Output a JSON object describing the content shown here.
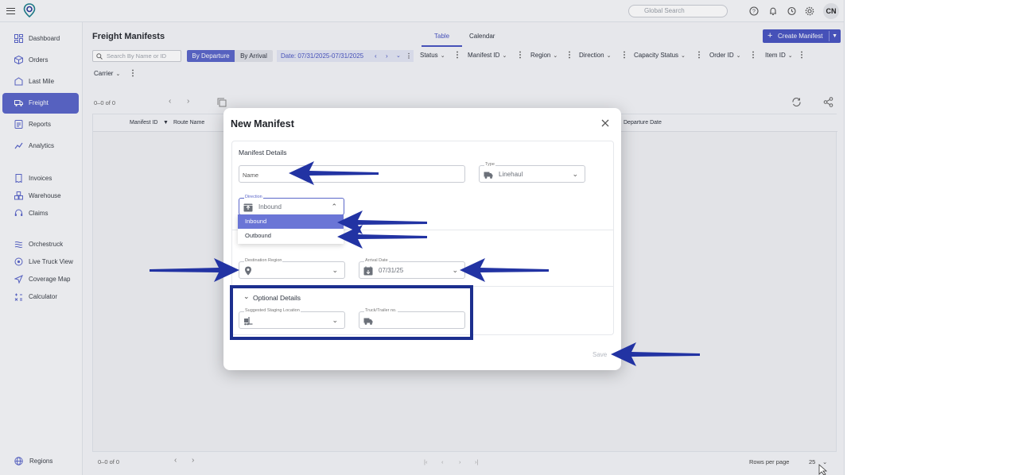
{
  "topbar": {
    "search_placeholder": "Global Search",
    "avatar_initials": "CN"
  },
  "sidebar": {
    "items": [
      {
        "label": "Dashboard",
        "icon": "dashboard-icon"
      },
      {
        "label": "Orders",
        "icon": "orders-box-icon"
      },
      {
        "label": "Last Mile",
        "icon": "last-mile-icon"
      },
      {
        "label": "Freight",
        "icon": "freight-truck-icon"
      },
      {
        "label": "Reports",
        "icon": "reports-icon"
      },
      {
        "label": "Analytics",
        "icon": "analytics-icon"
      },
      {
        "label": "Invoices",
        "icon": "invoices-icon"
      },
      {
        "label": "Warehouse",
        "icon": "warehouse-icon"
      },
      {
        "label": "Claims",
        "icon": "claims-headset-icon"
      },
      {
        "label": "Orchestruck",
        "icon": "orchestruck-icon"
      },
      {
        "label": "Live Truck View",
        "icon": "live-truck-view-icon"
      },
      {
        "label": "Coverage Map",
        "icon": "coverage-map-icon"
      },
      {
        "label": "Calculator",
        "icon": "calculator-icon"
      },
      {
        "label": "Regions",
        "icon": "globe-icon"
      }
    ],
    "active": "Freight"
  },
  "page": {
    "title": "Freight Manifests",
    "tabs": [
      "Table",
      "Calendar"
    ],
    "active_tab": "Table",
    "create_button": "Create Manifest",
    "filter_search_placeholder": "Search By Name or ID",
    "by_departure": "By Departure",
    "by_arrival": "By Arrival",
    "date_filter": "Date: 07/31/2025-07/31/2025",
    "filters": [
      "Status",
      "Manifest ID",
      "Region",
      "Direction",
      "Capacity Status",
      "Order ID",
      "Item ID",
      "Carrier"
    ],
    "pager_top": "0–0 of 0",
    "columns": [
      "Manifest ID",
      "Route Name",
      "Departure Date"
    ],
    "pager_bottom": "0–0 of 0",
    "rows_per_page_label": "Rows per page",
    "rows_per_page": "25"
  },
  "modal": {
    "title": "New Manifest",
    "manifest_details_label": "Manifest Details",
    "name_placeholder": "Name",
    "type_label": "Type",
    "type_value": "Linehaul",
    "direction_label": "Direction",
    "direction_value": "Inbound",
    "direction_options": [
      "Inbound",
      "Outbound"
    ],
    "selected_option": "Inbound",
    "destination_region_label": "Destination Region",
    "destination_region_value": "",
    "arrival_date_label": "Arrival Date",
    "arrival_date_value": "07/31/25",
    "optional_details_label": "Optional Details",
    "staging_location_label": "Suggested Staging Location",
    "truck_trailer_label": "Truck/Trailer no.",
    "save_label": "Save"
  },
  "colors": {
    "accent": "#4a56c2",
    "sidebar_active": "#5b67c9",
    "annotation": "#1c2f8e"
  }
}
